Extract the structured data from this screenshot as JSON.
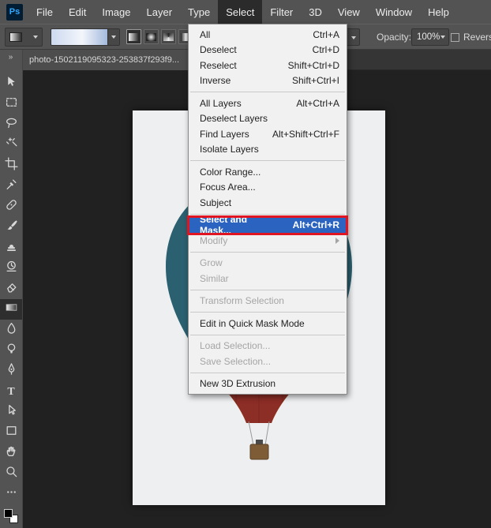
{
  "menubar": {
    "logo": "Ps",
    "items": [
      {
        "label": "File"
      },
      {
        "label": "Edit"
      },
      {
        "label": "Image"
      },
      {
        "label": "Layer"
      },
      {
        "label": "Type"
      },
      {
        "label": "Select",
        "active": true
      },
      {
        "label": "Filter"
      },
      {
        "label": "3D"
      },
      {
        "label": "View"
      },
      {
        "label": "Window"
      },
      {
        "label": "Help"
      }
    ]
  },
  "options_bar": {
    "opacity_label": "Opacity:",
    "opacity_value": "100%",
    "reverse_label": "Reverse",
    "gradient_types": [
      {
        "name": "linear-gradient-button",
        "type": "linear",
        "selected": true
      },
      {
        "name": "radial-gradient-button",
        "type": "radial"
      },
      {
        "name": "angle-gradient-button",
        "type": "angle"
      },
      {
        "name": "reflected-gradient-button",
        "type": "reflected"
      },
      {
        "name": "diamond-gradient-button",
        "type": "diamond"
      }
    ]
  },
  "document_tab": {
    "title": "photo-1502119095323-253837f293f9..."
  },
  "toolbar": {
    "expand_icon": "»",
    "foreground_color": "#000000",
    "background_color": "#ffffff",
    "tools": [
      {
        "name": "move-tool",
        "icon": "move-icon"
      },
      {
        "name": "rectangular-marquee-tool",
        "icon": "marquee-icon"
      },
      {
        "name": "lasso-tool",
        "icon": "lasso-icon"
      },
      {
        "name": "quick-selection-tool",
        "icon": "wand-icon"
      },
      {
        "name": "crop-tool",
        "icon": "crop-icon"
      },
      {
        "name": "eyedropper-tool",
        "icon": "eyedropper-icon"
      },
      {
        "name": "spot-healing-brush-tool",
        "icon": "healing-icon"
      },
      {
        "name": "brush-tool",
        "icon": "brush-icon"
      },
      {
        "name": "clone-stamp-tool",
        "icon": "stamp-icon"
      },
      {
        "name": "history-brush-tool",
        "icon": "history-icon"
      },
      {
        "name": "eraser-tool",
        "icon": "eraser-icon"
      },
      {
        "name": "gradient-tool",
        "icon": "gradient-icon",
        "selected": true
      },
      {
        "name": "blur-tool",
        "icon": "blur-icon"
      },
      {
        "name": "dodge-tool",
        "icon": "dodge-icon"
      },
      {
        "name": "pen-tool",
        "icon": "pen-icon"
      },
      {
        "name": "type-tool",
        "icon": "type-icon"
      },
      {
        "name": "path-selection-tool",
        "icon": "path-select-icon"
      },
      {
        "name": "rectangle-tool",
        "icon": "rectangle-icon"
      },
      {
        "name": "hand-tool",
        "icon": "hand-icon"
      },
      {
        "name": "zoom-tool",
        "icon": "zoom-icon"
      },
      {
        "name": "edit-toolbar",
        "icon": "ellipsis-icon"
      }
    ]
  },
  "select_menu": {
    "items": [
      {
        "label": "All",
        "shortcut": "Ctrl+A"
      },
      {
        "label": "Deselect",
        "shortcut": "Ctrl+D"
      },
      {
        "label": "Reselect",
        "shortcut": "Shift+Ctrl+D"
      },
      {
        "label": "Inverse",
        "shortcut": "Shift+Ctrl+I"
      },
      {
        "type": "separator"
      },
      {
        "label": "All Layers",
        "shortcut": "Alt+Ctrl+A"
      },
      {
        "label": "Deselect Layers"
      },
      {
        "label": "Find Layers",
        "shortcut": "Alt+Shift+Ctrl+F"
      },
      {
        "label": "Isolate Layers"
      },
      {
        "type": "separator"
      },
      {
        "label": "Color Range..."
      },
      {
        "label": "Focus Area..."
      },
      {
        "label": "Subject"
      },
      {
        "type": "separator"
      },
      {
        "label": "Select and Mask...",
        "shortcut": "Alt+Ctrl+R",
        "highlighted": true,
        "annotated": true
      },
      {
        "label": "Modify",
        "disabled": true,
        "submenu": true
      },
      {
        "type": "separator"
      },
      {
        "label": "Grow",
        "disabled": true
      },
      {
        "label": "Similar",
        "disabled": true
      },
      {
        "type": "separator"
      },
      {
        "label": "Transform Selection",
        "disabled": true
      },
      {
        "type": "separator"
      },
      {
        "label": "Edit in Quick Mask Mode"
      },
      {
        "type": "separator"
      },
      {
        "label": "Load Selection...",
        "disabled": true
      },
      {
        "label": "Save Selection...",
        "disabled": true
      },
      {
        "type": "separator"
      },
      {
        "label": "New 3D Extrusion"
      }
    ]
  },
  "colors": {
    "menu_highlight": "#2b63c0",
    "annotation_red": "#e11422",
    "ui_gray": "#535353"
  }
}
